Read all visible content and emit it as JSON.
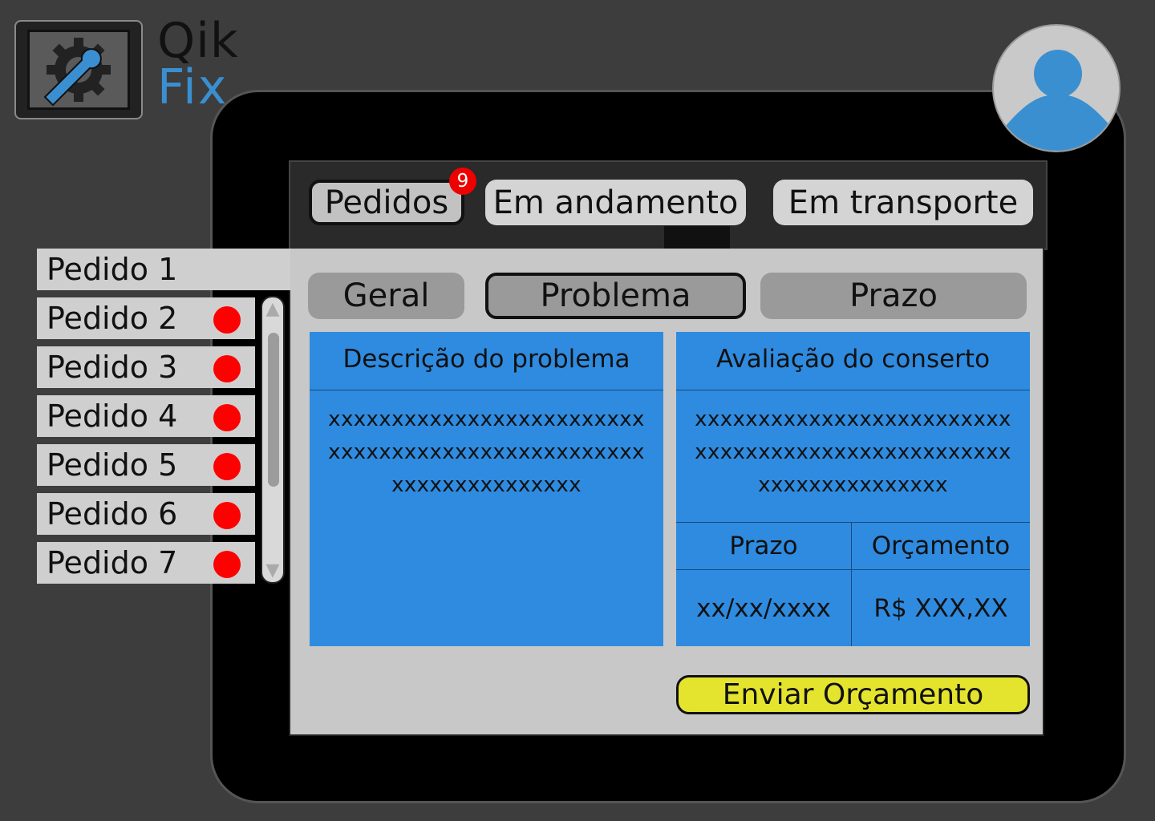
{
  "app": {
    "logo_line1": "Qik",
    "logo_line2": "Fix"
  },
  "tabs": [
    {
      "label": "Pedidos",
      "badge": "9"
    },
    {
      "label": "Em andamento"
    },
    {
      "label": "Em transporte"
    }
  ],
  "sub_tabs": [
    "Geral",
    "Problema",
    "Prazo"
  ],
  "orders": [
    {
      "label": "Pedido 1"
    },
    {
      "label": "Pedido 2"
    },
    {
      "label": "Pedido 3"
    },
    {
      "label": "Pedido 4"
    },
    {
      "label": "Pedido 5"
    },
    {
      "label": "Pedido 6"
    },
    {
      "label": "Pedido 7"
    }
  ],
  "problem_card": {
    "title": "Descrição do problema",
    "lines": [
      "xxxxxxxxxxxxxxxxxxxxxxxxx",
      "xxxxxxxxxxxxxxxxxxxxxxxxx",
      "xxxxxxxxxxxxxxx"
    ]
  },
  "repair_card": {
    "title": "Avaliação do conserto",
    "lines": [
      "xxxxxxxxxxxxxxxxxxxxxxxxx",
      "xxxxxxxxxxxxxxxxxxxxxxxxx",
      "xxxxxxxxxxxxxxx"
    ],
    "deadline_label": "Prazo",
    "budget_label": "Orçamento",
    "deadline_value": "xx/xx/xxxx",
    "budget_value": "R$ XXX,XX"
  },
  "send_button": "Enviar Orçamento",
  "colors": {
    "accent": "#2e8be0",
    "send": "#e4e42e",
    "badge": "#ee0000",
    "logo_fix": "#3a8fd0"
  }
}
